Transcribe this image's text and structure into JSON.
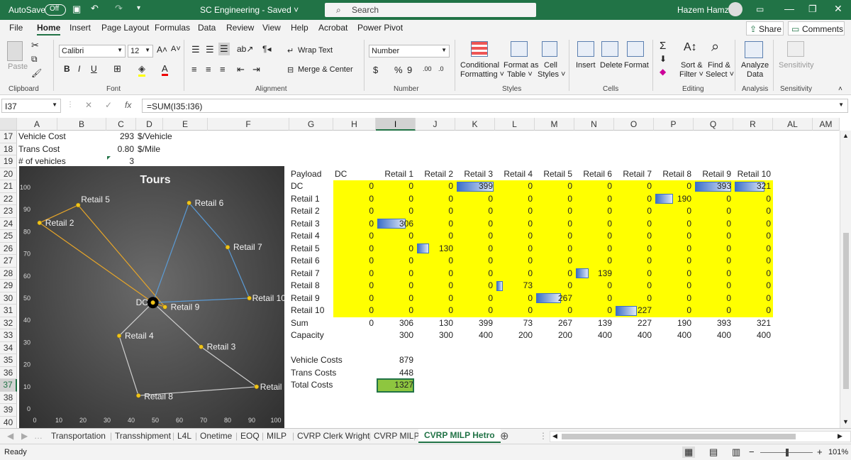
{
  "titlebar": {
    "autosave": "AutoSave",
    "autosave_state": "Off",
    "title": "SC Engineering - Saved ˅",
    "search": "Search",
    "user": "Hazem Hamza"
  },
  "menu": [
    "File",
    "Home",
    "Insert",
    "Page Layout",
    "Formulas",
    "Data",
    "Review",
    "View",
    "Help",
    "Acrobat",
    "Power Pivot"
  ],
  "menu_right": {
    "share": "Share",
    "comments": "Comments"
  },
  "ribbon": {
    "clipboard": {
      "paste": "Paste",
      "label": "Clipboard"
    },
    "font": {
      "name": "Calibri",
      "size": "12",
      "label": "Font",
      "bold": "B",
      "italic": "I",
      "underline": "U",
      "grow": "A˄",
      "shrink": "A˅",
      "color": "A"
    },
    "alignment": {
      "wrap": "Wrap Text",
      "merge": "Merge & Center",
      "label": "Alignment"
    },
    "number": {
      "format": "Number",
      "label": "Number",
      "currency": "$",
      "percent": "%",
      "comma": "9",
      "inc": ".00",
      "dec": ".0"
    },
    "styles": {
      "cond": "Conditional",
      "cond2": "Formatting ˅",
      "fmt": "Format as",
      "fmt2": "Table ˅",
      "cell": "Cell",
      "cell2": "Styles ˅",
      "label": "Styles"
    },
    "cells": {
      "insert": "Insert",
      "delete": "Delete",
      "format": "Format",
      "label": "Cells"
    },
    "editing": {
      "sort": "Sort &",
      "sort2": "Filter ˅",
      "find": "Find &",
      "find2": "Select ˅",
      "label": "Editing"
    },
    "analysis": {
      "analyze": "Analyze",
      "analyze2": "Data",
      "label": "Analysis"
    },
    "sensitivity": {
      "name": "Sensitivity",
      "label": "Sensitivity"
    }
  },
  "formula_bar": {
    "name_box": "I37",
    "fx": "fx",
    "formula": "=SUM(I35:I36)"
  },
  "columns": [
    "A",
    "B",
    "C",
    "D",
    "E",
    "F",
    "G",
    "H",
    "I",
    "J",
    "K",
    "L",
    "M",
    "N",
    "O",
    "P",
    "Q",
    "R",
    "AL",
    "AM"
  ],
  "rows": [
    "17",
    "18",
    "19",
    "20",
    "21",
    "22",
    "23",
    "24",
    "25",
    "26",
    "27",
    "28",
    "29",
    "30",
    "31",
    "32",
    "33",
    "34",
    "35",
    "36",
    "37",
    "38",
    "39",
    "40"
  ],
  "params": [
    {
      "label": "Vehicle Cost",
      "value": "293",
      "unit": "$/Vehicle"
    },
    {
      "label": "Trans Cost",
      "value": "0.80",
      "unit": "$/Mile"
    },
    {
      "label": "# of vehicles",
      "value": "3",
      "unit": ""
    }
  ],
  "payload": {
    "header": [
      "Payload",
      "DC",
      "Retail 1",
      "Retail 2",
      "Retail 3",
      "Retail 4",
      "Retail 5",
      "Retail 6",
      "Retail 7",
      "Retail 8",
      "Retail 9",
      "Retail 10"
    ],
    "rows": [
      {
        "name": "DC",
        "values": [
          "0",
          "0",
          "0",
          "399",
          "0",
          "0",
          "0",
          "0",
          "0",
          "393",
          "321"
        ]
      },
      {
        "name": "Retail 1",
        "values": [
          "0",
          "0",
          "0",
          "0",
          "0",
          "0",
          "0",
          "0",
          "190",
          "0",
          "0"
        ]
      },
      {
        "name": "Retail 2",
        "values": [
          "0",
          "0",
          "0",
          "0",
          "0",
          "0",
          "0",
          "0",
          "0",
          "0",
          "0"
        ]
      },
      {
        "name": "Retail 3",
        "values": [
          "0",
          "306",
          "0",
          "0",
          "0",
          "0",
          "0",
          "0",
          "0",
          "0",
          "0"
        ]
      },
      {
        "name": "Retail 4",
        "values": [
          "0",
          "0",
          "0",
          "0",
          "0",
          "0",
          "0",
          "0",
          "0",
          "0",
          "0"
        ]
      },
      {
        "name": "Retail 5",
        "values": [
          "0",
          "0",
          "130",
          "0",
          "0",
          "0",
          "0",
          "0",
          "0",
          "0",
          "0"
        ]
      },
      {
        "name": "Retail 6",
        "values": [
          "0",
          "0",
          "0",
          "0",
          "0",
          "0",
          "0",
          "0",
          "0",
          "0",
          "0"
        ]
      },
      {
        "name": "Retail 7",
        "values": [
          "0",
          "0",
          "0",
          "0",
          "0",
          "0",
          "139",
          "0",
          "0",
          "0",
          "0"
        ]
      },
      {
        "name": "Retail 8",
        "values": [
          "0",
          "0",
          "0",
          "0",
          "73",
          "0",
          "0",
          "0",
          "0",
          "0",
          "0"
        ]
      },
      {
        "name": "Retail 9",
        "values": [
          "0",
          "0",
          "0",
          "0",
          "0",
          "267",
          "0",
          "0",
          "0",
          "0",
          "0"
        ]
      },
      {
        "name": "Retail 10",
        "values": [
          "0",
          "0",
          "0",
          "0",
          "0",
          "0",
          "0",
          "227",
          "0",
          "0",
          "0"
        ]
      }
    ],
    "sum": {
      "name": "Sum",
      "values": [
        "0",
        "306",
        "130",
        "399",
        "73",
        "267",
        "139",
        "227",
        "190",
        "393",
        "321"
      ]
    },
    "capacity": {
      "name": "Capacity",
      "values": [
        "",
        "300",
        "300",
        "400",
        "200",
        "200",
        "400",
        "400",
        "400",
        "400",
        "400"
      ]
    }
  },
  "costs": [
    {
      "label": "Vehicle Costs",
      "value": "879"
    },
    {
      "label": "Trans Costs",
      "value": "448"
    },
    {
      "label": "Total Costs",
      "value": "1327"
    }
  ],
  "chart_data": {
    "type": "scatter",
    "title": "Tours",
    "xlim": [
      0,
      100
    ],
    "ylim": [
      0,
      100
    ],
    "xticks": [
      "0",
      "10",
      "20",
      "30",
      "40",
      "50",
      "60",
      "70",
      "80",
      "90",
      "100"
    ],
    "yticks": [
      "0",
      "10",
      "20",
      "30",
      "40",
      "50",
      "60",
      "70",
      "80",
      "90",
      "100"
    ],
    "points": [
      {
        "name": "DC",
        "x": 49,
        "y": 48
      },
      {
        "name": "Retail 1",
        "x": 92,
        "y": 10
      },
      {
        "name": "Retail 2",
        "x": 2,
        "y": 84
      },
      {
        "name": "Retail 3",
        "x": 69,
        "y": 28
      },
      {
        "name": "Retail 4",
        "x": 35,
        "y": 33
      },
      {
        "name": "Retail 5",
        "x": 18,
        "y": 92
      },
      {
        "name": "Retail 6",
        "x": 64,
        "y": 93
      },
      {
        "name": "Retail 7",
        "x": 80,
        "y": 73
      },
      {
        "name": "Retail 8",
        "x": 43,
        "y": 6
      },
      {
        "name": "Retail 9",
        "x": 54,
        "y": 46
      },
      {
        "name": "Retail 10",
        "x": 89,
        "y": 50
      }
    ],
    "routes": [
      {
        "stops": [
          "DC",
          "Retail 3",
          "Retail 1",
          "Retail 8",
          "Retail 4",
          "DC"
        ],
        "color": "#cfcfcf"
      },
      {
        "stops": [
          "DC",
          "Retail 9",
          "Retail 5",
          "Retail 2",
          "DC"
        ],
        "color": "#e6a529"
      },
      {
        "stops": [
          "DC",
          "Retail 10",
          "Retail 7",
          "Retail 6",
          "DC"
        ],
        "color": "#5b9bd5"
      }
    ]
  },
  "sheet_tabs": [
    "Transportation",
    "Transshipment",
    "L4L",
    "Onetime",
    "EOQ",
    "MILP",
    "CVRP Clerk Wright",
    "CVRP MILP",
    "CVRP MILP Hetro"
  ],
  "status": {
    "ready": "Ready",
    "zoom": "101%"
  }
}
